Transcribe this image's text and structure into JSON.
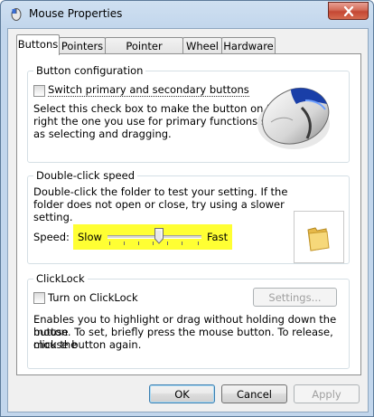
{
  "window": {
    "title": "Mouse Properties"
  },
  "tabs": [
    {
      "label": "Buttons",
      "active": true
    },
    {
      "label": "Pointers",
      "active": false
    },
    {
      "label": "Pointer Options",
      "active": false
    },
    {
      "label": "Wheel",
      "active": false
    },
    {
      "label": "Hardware",
      "active": false
    }
  ],
  "button_configuration": {
    "title": "Button configuration",
    "checkbox_label": "Switch primary and secondary buttons",
    "checked": false,
    "description_lines": [
      "Select this check box to make the button on the",
      "right the one you use for primary functions such",
      "as selecting and dragging."
    ]
  },
  "double_click": {
    "title": "Double-click speed",
    "description_lines": [
      "Double-click the folder to test your setting. If the",
      "folder does not open or close, try using a slower",
      "setting."
    ],
    "speed_label": "Speed:",
    "slow_label": "Slow",
    "fast_label": "Fast",
    "speed_value_fraction": 0.55,
    "highlight_color": "#ffff33"
  },
  "clicklock": {
    "title": "ClickLock",
    "checkbox_label": "Turn on ClickLock",
    "checked": false,
    "settings_button": "Settings...",
    "description_lines": [
      "Enables you to highlight or drag without holding down the mouse",
      "button. To set, briefly press the mouse button. To release, click the",
      "mouse button again."
    ]
  },
  "footer": {
    "ok": "OK",
    "cancel": "Cancel",
    "apply": "Apply"
  }
}
